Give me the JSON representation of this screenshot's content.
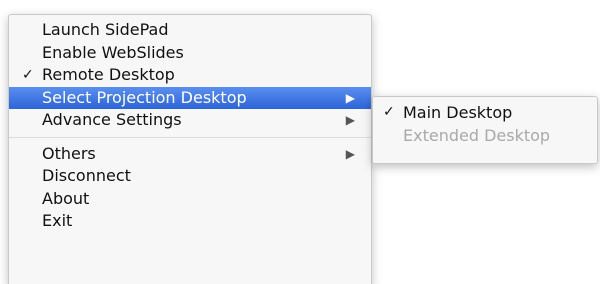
{
  "main_menu": {
    "items": [
      {
        "label": "Launch SidePad",
        "checked": false,
        "has_submenu": false
      },
      {
        "label": "Enable WebSlides",
        "checked": false,
        "has_submenu": false
      },
      {
        "label": "Remote Desktop",
        "checked": true,
        "has_submenu": false
      },
      {
        "label": "Select Projection Desktop",
        "checked": false,
        "has_submenu": true,
        "highlighted": true
      },
      {
        "label": "Advance Settings",
        "checked": false,
        "has_submenu": true
      },
      {
        "label": "Others",
        "checked": false,
        "has_submenu": true
      },
      {
        "label": "Disconnect",
        "checked": false,
        "has_submenu": false
      },
      {
        "label": "About",
        "checked": false,
        "has_submenu": false
      },
      {
        "label": "Exit",
        "checked": false,
        "has_submenu": false
      }
    ]
  },
  "sub_menu": {
    "items": [
      {
        "label": "Main Desktop",
        "checked": true,
        "enabled": true
      },
      {
        "label": "Extended Desktop",
        "checked": false,
        "enabled": false
      }
    ]
  },
  "glyphs": {
    "check": "✓",
    "submenu_arrow": "▶"
  },
  "colors": {
    "highlight": "#2d64d8",
    "disabled_text": "#a9a9a9"
  }
}
